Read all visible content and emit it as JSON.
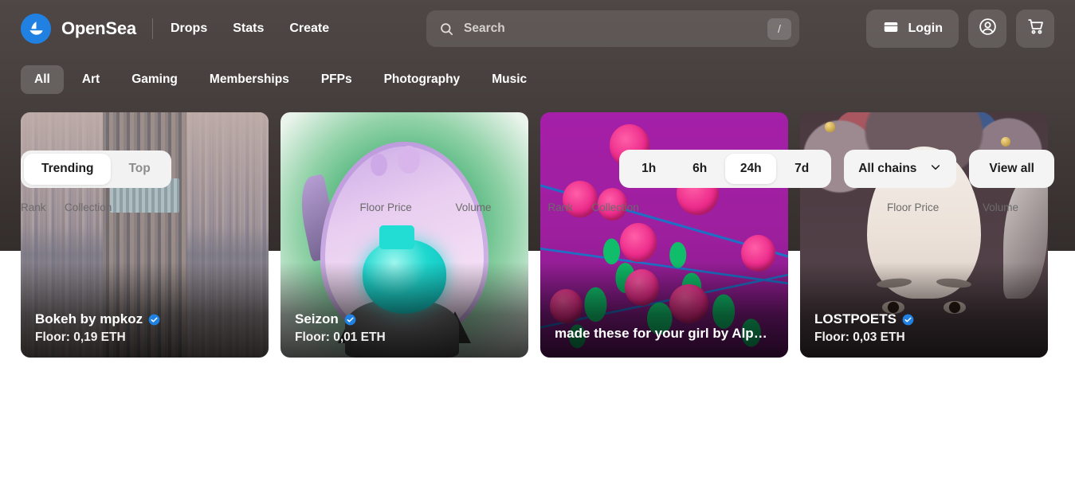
{
  "brand": {
    "name": "OpenSea",
    "logo_icon": "sailboat-icon",
    "logo_color": "#2081e2"
  },
  "nav": {
    "links": [
      {
        "label": "Drops"
      },
      {
        "label": "Stats"
      },
      {
        "label": "Create"
      }
    ]
  },
  "search": {
    "placeholder": "Search",
    "value": "",
    "icon": "search-icon",
    "shortcut": "/"
  },
  "header_actions": {
    "login_label": "Login",
    "login_icon": "wallet-icon",
    "account_icon": "account-circle-icon",
    "cart_icon": "shopping-cart-icon"
  },
  "categories": {
    "active": "All",
    "items": [
      {
        "label": "All"
      },
      {
        "label": "Art"
      },
      {
        "label": "Gaming"
      },
      {
        "label": "Memberships"
      },
      {
        "label": "PFPs"
      },
      {
        "label": "Photography"
      },
      {
        "label": "Music"
      }
    ]
  },
  "featured_cards": [
    {
      "title": "Bokeh by mpkoz",
      "floor": "Floor: 0,19 ETH",
      "verified": true,
      "art": "abstract-vertical-strips"
    },
    {
      "title": "Seizon",
      "floor": "Floor: 0,01 ETH",
      "verified": true,
      "art": "anime-character-green"
    },
    {
      "title": "made these for your girl by Alpha…",
      "floor": "",
      "verified": false,
      "art": "pink-roses-magenta"
    },
    {
      "title": "LOSTPOETS",
      "floor": "Floor: 0,03 ETH",
      "verified": true,
      "art": "portrait-painting"
    }
  ],
  "list_controls": {
    "ranking_tabs": {
      "active": "Trending",
      "items": [
        {
          "label": "Trending"
        },
        {
          "label": "Top"
        }
      ]
    },
    "time_range": {
      "active": "24h",
      "items": [
        {
          "label": "1h"
        },
        {
          "label": "6h"
        },
        {
          "label": "24h"
        },
        {
          "label": "7d"
        }
      ]
    },
    "chain_filter": {
      "label": "All chains",
      "icon": "chevron-down-icon"
    },
    "view_all_label": "View all"
  },
  "table": {
    "headers": {
      "rank": "Rank",
      "collection": "Collection",
      "floor_price": "Floor Price",
      "volume": "Volume"
    }
  },
  "colors": {
    "accent": "#2081e2",
    "verified_badge": "#2081e2",
    "dark_header": "#4a4341",
    "body_bg": "#ffffff"
  }
}
